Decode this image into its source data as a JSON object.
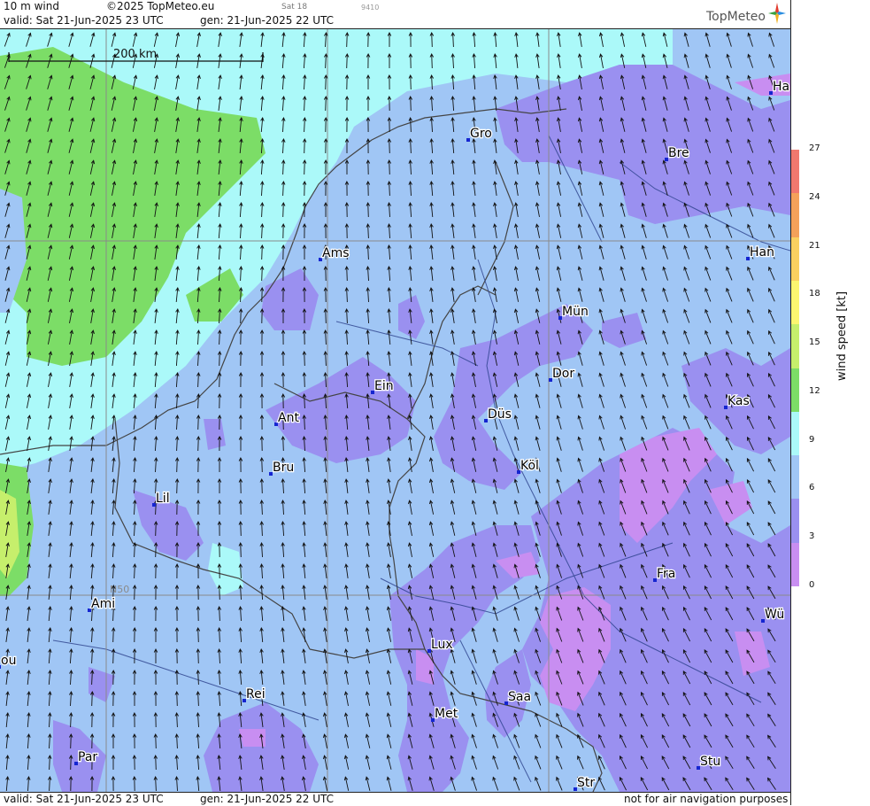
{
  "header": {
    "product": "10 m wind",
    "copyright": "©2025 TopMeteo.eu",
    "run_tag": "Sat 18",
    "code": "9410",
    "valid": "valid:  Sat  21-Jun-2025  23 UTC",
    "generated": "gen: 21-Jun-2025 22 UTC",
    "logo": "TopMeteo"
  },
  "footer": {
    "valid": "valid:  Sat  21-Jun-2025  23 UTC",
    "generated": "gen: 21-Jun-2025 22 UTC",
    "disclaimer": "not for air navigation purposes"
  },
  "map": {
    "scale_label": "200 km",
    "latitude_label": "N50",
    "cities": [
      {
        "label": "Ha"
      },
      {
        "label": "Gro"
      },
      {
        "label": "Bre"
      },
      {
        "label": "Ams"
      },
      {
        "label": "Han"
      },
      {
        "label": "Mün"
      },
      {
        "label": "Ein"
      },
      {
        "label": "Dor"
      },
      {
        "label": "Ant"
      },
      {
        "label": "Düs"
      },
      {
        "label": "Kas"
      },
      {
        "label": "Bru"
      },
      {
        "label": "Köl"
      },
      {
        "label": "Lil"
      },
      {
        "label": "Fra"
      },
      {
        "label": "Ami"
      },
      {
        "label": "Wü"
      },
      {
        "label": "ou"
      },
      {
        "label": "Lux"
      },
      {
        "label": "Rei"
      },
      {
        "label": "Saa"
      },
      {
        "label": "Met"
      },
      {
        "label": "Par"
      },
      {
        "label": "Stu"
      },
      {
        "label": "Str"
      }
    ]
  },
  "legend": {
    "title": "wind speed [kt]",
    "ticks": [
      "27",
      "24",
      "21",
      "18",
      "15",
      "12",
      "9",
      "6",
      "3",
      "0"
    ],
    "colors": [
      "#f0786e",
      "#f4a15a",
      "#fad060",
      "#fcf670",
      "#c6ef6c",
      "#7cdd67",
      "#abf9f9",
      "#a0c6f5",
      "#9a90f0",
      "#c88ef1"
    ]
  },
  "colors": {
    "calm": "#c88ef1",
    "light": "#9a90f0",
    "moderate": "#a0c6f5",
    "fresh": "#abf9f9",
    "strong": "#7cdd67",
    "border": "#444444",
    "river": "#2a3f8a"
  }
}
